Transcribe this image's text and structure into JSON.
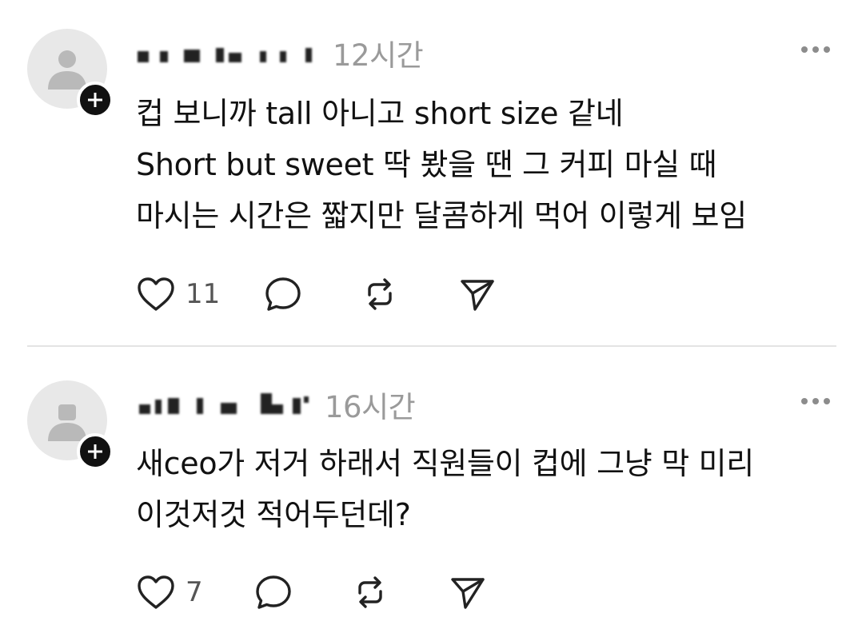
{
  "posts": [
    {
      "timestamp": "12시간",
      "lines": [
        "컵 보니까 tall 아니고 short size 같네",
        "Short but sweet 딱 봤을 땐 그 커피 마실 때",
        "마시는 시간은 짧지만 달콤하게 먹어 이렇게 보임"
      ],
      "like_count": "11",
      "icons": [
        "heart-icon",
        "comment-icon",
        "repost-icon",
        "share-icon"
      ]
    },
    {
      "timestamp": "16시간",
      "lines": [
        "새ceo가 저거 하래서 직원들이 컵에 그냥 막 미리",
        "이것저것 적어두던데?"
      ],
      "like_count": "7",
      "icons": [
        "heart-icon",
        "comment-icon",
        "repost-icon",
        "share-icon"
      ]
    }
  ]
}
